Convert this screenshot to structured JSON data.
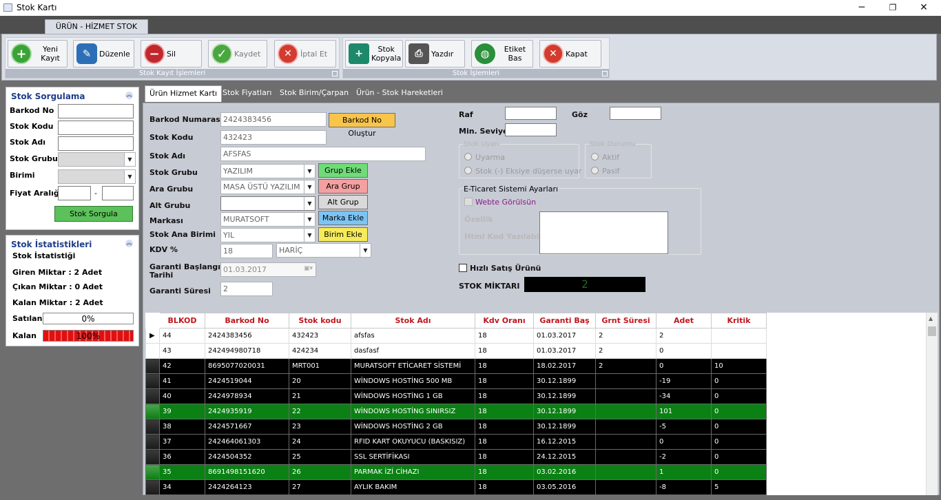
{
  "window": {
    "title": "Stok Kartı",
    "min": "─",
    "max": "❐",
    "close": "✕"
  },
  "ribbon": {
    "tab": "ÜRÜN - HİZMET STOK KARTI",
    "group1_label": "Stok Kayıt İşlemleri",
    "group2_label": "Stok İşlemleri",
    "buttons": {
      "new": "Yeni Kayıt",
      "edit": "Düzenle",
      "delete": "Sil",
      "save": "Kaydet",
      "cancel": "İptal Et",
      "copy": "Stok\nKopyala",
      "print": "Yazdır",
      "label": "Etiket Bas",
      "close": "Kapat"
    },
    "colors": {
      "new": "#3aa336",
      "edit": "#2d6fb6",
      "delete": "#c1272d",
      "save": "#4aa63e",
      "cancel": "#d33b2f",
      "copy": "#1c8a6a",
      "print": "#555555",
      "label": "#2a8f3a",
      "close": "#d33b2f"
    }
  },
  "search": {
    "title": "Stok Sorgulama",
    "barkod_label": "Barkod No",
    "kod_label": "Stok Kodu",
    "ad_label": "Stok Adı",
    "grup_label": "Stok Grubu",
    "birim_label": "Birimi",
    "fiyat_label": "Fiyat Aralığı",
    "dash": "-",
    "button": "Stok Sorgula"
  },
  "stats": {
    "title": "Stok İstatistikleri",
    "subtitle": "Stok İstatistiği",
    "giren": "Giren Miktar : 2 Adet",
    "cikan": "Çıkan Miktar : 0 Adet",
    "kalan_text": "Kalan Miktar : 2 Adet",
    "satilan_label": "Satılan",
    "satilan_value": "0%",
    "satilan_fraction": 0,
    "kalan_label": "Kalan",
    "kalan_value": "100%",
    "kalan_fraction": 1
  },
  "tabs": [
    "Ürün Hizmet Kartı",
    "Stok Fiyatları",
    "Stok Birim/Çarpan",
    "Ürün - Stok Hareketleri"
  ],
  "form": {
    "barkod_label": "Barkod Numarası",
    "barkod": "2424383456",
    "barkod_btn": "Barkod No Oluştur",
    "kod_label": "Stok Kodu",
    "kod": "432423",
    "ad_label": "Stok Adı",
    "ad": "AFSFAS",
    "grup_label": "Stok Grubu",
    "grup": "YAZILIM",
    "grup_btn": "Grup Ekle",
    "ara_label": "Ara Grubu",
    "ara": "MASA ÜSTÜ YAZILIM",
    "ara_btn": "Ara Grup Ekle",
    "alt_label": "Alt Grubu",
    "alt": "",
    "alt_btn": "Alt Grup Ekle",
    "marka_label": "Markası",
    "marka": "MURATSOFT",
    "marka_btn": "Marka Ekle",
    "birim_label": "Stok Ana Birimi",
    "birim": "YIL",
    "birim_btn": "Birim Ekle",
    "kdv_label": "KDV %",
    "kdv": "18",
    "kdv_type": "HARİÇ",
    "garanti_bas_label": "Garanti Başlangıç\nTarihi",
    "garanti_bas": "01.03.2017",
    "garanti_sure_label": "Garanti Süresi",
    "garanti_sure": "2",
    "raf_label": "Raf",
    "goz_label": "Göz",
    "min_label": "Min. Seviye",
    "uyari_legend": "Stok Uyarı",
    "uyari_opt1": "Uyarma",
    "uyari_opt2": "Stok (-) Eksiye düşerse uyar",
    "durum_legend": "Stok Durumu",
    "durum_opt1": "Aktif",
    "durum_opt2": "Pasif",
    "eticaret_legend": "E-Ticaret Sistemi Ayarları",
    "webte": "Webte Görülsün",
    "ozellik": "Özellik",
    "html_kod": "Html Kod Yazılabilir",
    "hizli": "Hızlı Satış Ürünü",
    "stok_miktari_label": "STOK MİKTARI",
    "stok_miktari": "2"
  },
  "table": {
    "headers": [
      "BLKOD",
      "Barkod No",
      "Stok kodu",
      "Stok Adı",
      "Kdv Oranı",
      "Garanti Baş",
      "Grnt Süresi",
      "Adet",
      "Kritik"
    ],
    "rows": [
      {
        "style": "rw",
        "cells": [
          "44",
          "2424383456",
          "432423",
          "afsfas",
          "18",
          "01.03.2017",
          "2",
          "2",
          ""
        ],
        "current": true
      },
      {
        "style": "rw",
        "cells": [
          "43",
          "242494980718",
          "424234",
          "dasfasf",
          "18",
          "01.03.2017",
          "2",
          "0",
          ""
        ]
      },
      {
        "style": "rb",
        "cells": [
          "42",
          "8695077020031",
          "MRT001",
          "MURATSOFT ETİCARET SİSTEMİ",
          "18",
          "18.02.2017",
          "2",
          "0",
          "10"
        ]
      },
      {
        "style": "rb",
        "cells": [
          "41",
          "2424519044",
          "20",
          "WİNDOWS HOSTİNG 500 MB",
          "18",
          "30.12.1899",
          "",
          "-19",
          "0"
        ]
      },
      {
        "style": "rb",
        "cells": [
          "40",
          "2424978934",
          "21",
          "WİNDOWS HOSTİNG 1 GB",
          "18",
          "30.12.1899",
          "",
          "-34",
          "0"
        ]
      },
      {
        "style": "rg",
        "cells": [
          "39",
          "2424935919",
          "22",
          "WİNDOWS HOSTİNG SINIRSIZ",
          "18",
          "30.12.1899",
          "",
          "101",
          "0"
        ]
      },
      {
        "style": "rb",
        "cells": [
          "38",
          "2424571667",
          "23",
          "WİNDOWS HOSTİNG 2 GB",
          "18",
          "30.12.1899",
          "",
          "-5",
          "0"
        ]
      },
      {
        "style": "rb",
        "cells": [
          "37",
          "242464061303",
          "24",
          "RFID KART OKUYUCU (BASKISIZ)",
          "18",
          "16.12.2015",
          "",
          "0",
          "0"
        ]
      },
      {
        "style": "rb",
        "cells": [
          "36",
          "2424504352",
          "25",
          "SSL SERTİFİKASI",
          "18",
          "24.12.2015",
          "",
          "-2",
          "0"
        ]
      },
      {
        "style": "rg",
        "cells": [
          "35",
          "8691498151620",
          "26",
          "PARMAK İZİ CİHAZI",
          "18",
          "03.02.2016",
          "",
          "1",
          "0"
        ]
      },
      {
        "style": "rb",
        "cells": [
          "34",
          "2424264123",
          "27",
          "AYLIK BAKIM",
          "18",
          "03.05.2016",
          "",
          "-8",
          "5"
        ]
      }
    ]
  }
}
